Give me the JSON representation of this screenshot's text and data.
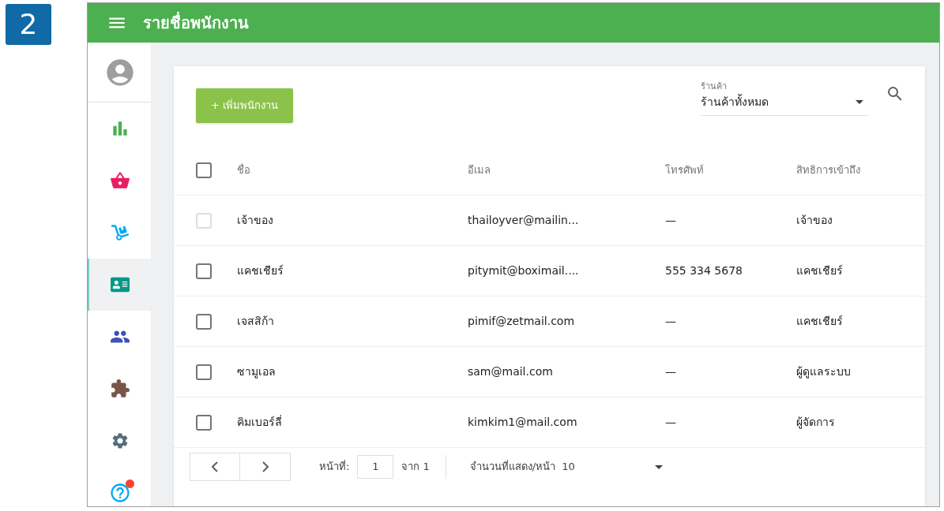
{
  "step_badge": "2",
  "app_bar": {
    "title": "รายชื่อพนักงาน"
  },
  "sidebar": {
    "items": [
      {
        "kind": "account",
        "selected": false,
        "notification": false
      },
      {
        "kind": "chart",
        "selected": false,
        "notification": false
      },
      {
        "kind": "basket",
        "selected": false,
        "notification": false
      },
      {
        "kind": "dolly",
        "selected": false,
        "notification": false
      },
      {
        "kind": "idcard",
        "selected": true,
        "notification": false
      },
      {
        "kind": "people",
        "selected": false,
        "notification": false
      },
      {
        "kind": "puzzle",
        "selected": false,
        "notification": false
      },
      {
        "kind": "settings",
        "selected": false,
        "notification": false
      },
      {
        "kind": "help",
        "selected": false,
        "notification": true
      }
    ]
  },
  "toolbar": {
    "add_button": "+ เพิ่มพนักงาน",
    "store_select": {
      "label": "ร้านค้า",
      "value": "ร้านค้าทั้งหมด"
    }
  },
  "table": {
    "columns": [
      "ชื่อ",
      "อีเมล",
      "โทรศัพท์",
      "สิทธิการเข้าถึง"
    ],
    "header_checked": false,
    "rows": [
      {
        "name": "เจ้าของ",
        "email": "thailoyver@mailin...",
        "phone": "—",
        "role": "เจ้าของ",
        "checked": false,
        "disabled": true
      },
      {
        "name": "แคชเชียร์",
        "email": "pitymit@boximail....",
        "phone": "555 334 5678",
        "role": "แคชเชียร์",
        "checked": false,
        "disabled": false
      },
      {
        "name": "เจสสิก้า",
        "email": "pimif@zetmail.com",
        "phone": "—",
        "role": "แคชเชียร์",
        "checked": false,
        "disabled": false
      },
      {
        "name": "ซามูเอล",
        "email": "sam@mail.com",
        "phone": "—",
        "role": "ผู้ดูแลระบบ",
        "checked": false,
        "disabled": false
      },
      {
        "name": "คิมเบอร์ลี่",
        "email": "kimkim1@mail.com",
        "phone": "—",
        "role": "ผู้จัดการ",
        "checked": false,
        "disabled": false
      }
    ]
  },
  "pagination": {
    "page_label": "หน้าที่:",
    "page": "1",
    "of": "จาก 1",
    "per_page_label": "จำนวนที่แสดง/หน้า",
    "per_page": "10"
  }
}
